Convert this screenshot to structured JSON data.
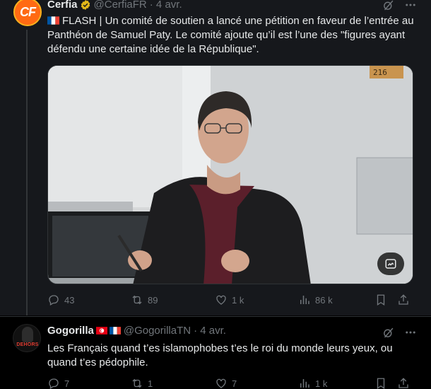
{
  "tweets": [
    {
      "name": "Cerfia",
      "handle": "@CerfiaFR",
      "date": "· 4 avr.",
      "avatar_text": "CF",
      "verified_color": "#e2b719",
      "text": "FLASH | Un comité de soutien a lancé une pétition en faveur de l’entrée au Panthéon de Samuel Paty. Le comité ajoute qu’il est l’une des \"figures ayant défendu une certaine idée de la République\".",
      "actions": {
        "replies": "43",
        "reposts": "89",
        "likes": "1 k",
        "views": "86 k"
      }
    },
    {
      "name": "Gogorilla",
      "handle": "@GogorillaTN",
      "date": "· 4 avr.",
      "avatar_label": "DEHORS",
      "text": "Les Français quand t’es islamophobes t’es le roi du monde leurs yeux, ou quand t’es pédophile.",
      "actions": {
        "replies": "7",
        "reposts": "1",
        "likes": "7",
        "views": "1 k"
      }
    }
  ],
  "icons": [
    "grok-icon",
    "more-icon",
    "reply-icon",
    "repost-icon",
    "like-icon",
    "views-icon",
    "bookmark-icon",
    "share-icon",
    "verified-badge-icon",
    "edit-image-icon"
  ],
  "colors": {
    "background": "#000000",
    "highlight": "#16181c",
    "text": "#e7e9ea",
    "muted": "#71767b",
    "border": "#2f3336"
  }
}
